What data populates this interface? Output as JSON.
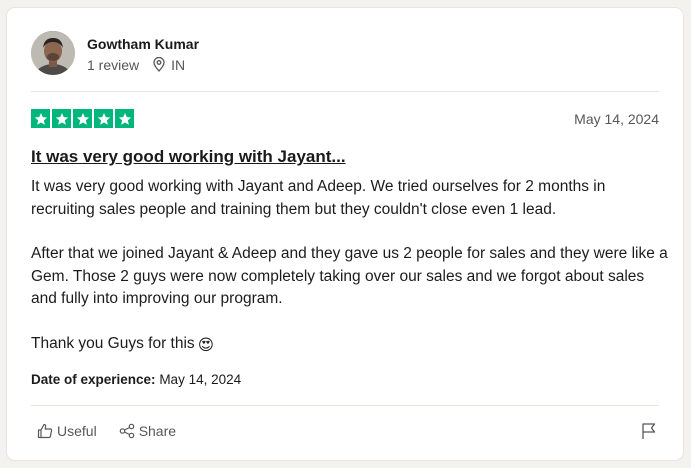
{
  "reviewer": {
    "name": "Gowtham Kumar",
    "reviews": "1 review",
    "country": "IN"
  },
  "review": {
    "rating": 5,
    "date": "May 14, 2024",
    "title": "It was very good working with Jayant...",
    "paragraphs": [
      "It was very good working with Jayant and Adeep. We tried ourselves for 2 months in recruiting sales people and training them but they couldn't close even 1 lead.",
      "After that we joined Jayant & Adeep and they gave us 2 people for sales and they were like a Gem. Those 2 guys were now completely taking over our sales and we forgot about sales and fully into improving our program.",
      "Thank you Guys for this"
    ],
    "emoji": "😍",
    "experience_label": "Date of experience:",
    "experience_date": "May 14, 2024"
  },
  "actions": {
    "useful_label": "Useful",
    "share_label": "Share"
  },
  "colors": {
    "star_green": "#00b67a",
    "background": "#f3f2ee"
  },
  "icons": [
    "location-pin-icon",
    "thumbs-up-icon",
    "share-icon",
    "flag-icon",
    "star-icon"
  ]
}
